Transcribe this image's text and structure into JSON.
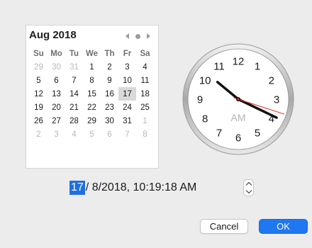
{
  "calendar": {
    "month_label": "Aug 2018",
    "weekdays": [
      "Su",
      "Mo",
      "Tu",
      "We",
      "Th",
      "Fr",
      "Sa"
    ],
    "days": [
      {
        "label": "29",
        "state": "other"
      },
      {
        "label": "30",
        "state": "other"
      },
      {
        "label": "31",
        "state": "other"
      },
      {
        "label": "1",
        "state": "current"
      },
      {
        "label": "2",
        "state": "current"
      },
      {
        "label": "3",
        "state": "current"
      },
      {
        "label": "4",
        "state": "current"
      },
      {
        "label": "5",
        "state": "current"
      },
      {
        "label": "6",
        "state": "current"
      },
      {
        "label": "7",
        "state": "current"
      },
      {
        "label": "8",
        "state": "current"
      },
      {
        "label": "9",
        "state": "current"
      },
      {
        "label": "10",
        "state": "current"
      },
      {
        "label": "11",
        "state": "current"
      },
      {
        "label": "12",
        "state": "current"
      },
      {
        "label": "13",
        "state": "current"
      },
      {
        "label": "14",
        "state": "current"
      },
      {
        "label": "15",
        "state": "current"
      },
      {
        "label": "16",
        "state": "current"
      },
      {
        "label": "17",
        "state": "selected"
      },
      {
        "label": "18",
        "state": "current"
      },
      {
        "label": "19",
        "state": "current"
      },
      {
        "label": "20",
        "state": "current"
      },
      {
        "label": "21",
        "state": "current"
      },
      {
        "label": "22",
        "state": "current"
      },
      {
        "label": "23",
        "state": "current"
      },
      {
        "label": "24",
        "state": "current"
      },
      {
        "label": "25",
        "state": "current"
      },
      {
        "label": "26",
        "state": "current"
      },
      {
        "label": "27",
        "state": "current"
      },
      {
        "label": "28",
        "state": "current"
      },
      {
        "label": "29",
        "state": "current"
      },
      {
        "label": "30",
        "state": "current"
      },
      {
        "label": "31",
        "state": "current"
      },
      {
        "label": "1",
        "state": "other"
      },
      {
        "label": "2",
        "state": "other"
      },
      {
        "label": "3",
        "state": "other"
      },
      {
        "label": "4",
        "state": "other"
      },
      {
        "label": "5",
        "state": "other"
      },
      {
        "label": "6",
        "state": "other"
      },
      {
        "label": "7",
        "state": "other"
      },
      {
        "label": "8",
        "state": "other"
      }
    ],
    "nav_icons": [
      "chevron-left-icon",
      "today-dot-icon",
      "chevron-right-icon"
    ]
  },
  "clock": {
    "numbers": [
      "12",
      "1",
      "2",
      "3",
      "4",
      "5",
      "6",
      "7",
      "8",
      "9",
      "10",
      "11"
    ],
    "period": "AM",
    "time": {
      "hour": 10,
      "minute": 19,
      "second": 18
    }
  },
  "datetime_field": {
    "day_segment": "17",
    "rest": "/ 8/2018, 10:19:18 AM"
  },
  "buttons": {
    "cancel": "Cancel",
    "ok": "OK"
  },
  "colors": {
    "accent": "#1f78f2",
    "second_hand": "#e0302a",
    "selected_day_bg": "#d9d9d9"
  }
}
